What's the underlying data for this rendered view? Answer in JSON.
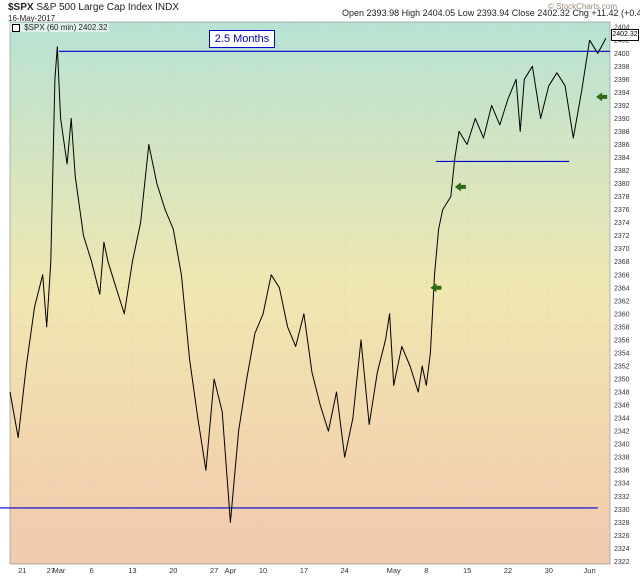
{
  "header": {
    "symbol": "$SPX",
    "name": "S&P 500 Large Cap Index",
    "exchange": "INDX",
    "date": "16-May-2017",
    "watermark": "© StockCharts.com",
    "open_label": "Open",
    "open": "2393.98",
    "high_label": "High",
    "high": "2404.05",
    "low_label": "Low",
    "low": "2393.94",
    "close_label": "Close",
    "close": "2402.32",
    "chg_label": "Chg",
    "chg": "+11.42 (+0.48%)",
    "legend_symbol": "$SPX (60 min)",
    "legend_value": "2402.32"
  },
  "annotation": {
    "label": "2.5 Months"
  },
  "colors": {
    "background_top": "#b7e3d3",
    "background_mid": "#f1e7b0",
    "background_bottom": "#f2c9ad",
    "price": "#000000",
    "lines": "#0000cc",
    "arrows": "#2d6b16",
    "grid": "#c9c9b8",
    "watermark": "#9b8a7a"
  },
  "chart_data": {
    "type": "line",
    "title": "$SPX S&P 500 Large Cap Index INDX",
    "timeframe": "60 min",
    "x_tick_labels": [
      "21",
      "27",
      "Mar",
      "6",
      "13",
      "20",
      "27",
      "Apr",
      "10",
      "17",
      "24",
      "May",
      "8",
      "15",
      "22",
      "30",
      "Jun"
    ],
    "x_tick_positions": [
      1.5,
      5,
      6,
      10,
      15,
      20,
      25,
      27,
      31,
      36,
      41,
      47,
      51,
      56,
      61,
      66,
      71
    ],
    "y_tick_labels": [
      2404,
      2402,
      2400,
      2398,
      2396,
      2394,
      2392,
      2390,
      2388,
      2386,
      2384,
      2382,
      2380,
      2378,
      2376,
      2374,
      2372,
      2370,
      2368,
      2366,
      2364,
      2362,
      2360,
      2358,
      2356,
      2354,
      2352,
      2350,
      2348,
      2346,
      2344,
      2342,
      2340,
      2338,
      2336,
      2334,
      2332,
      2330,
      2328,
      2326,
      2324,
      2322
    ],
    "ylim": [
      2321.6,
      2404.8
    ],
    "xlim": [
      0,
      73.5
    ],
    "series": [
      {
        "values": [
          [
            0,
            2348
          ],
          [
            1,
            2341
          ],
          [
            2,
            2352
          ],
          [
            3,
            2361
          ],
          [
            4,
            2366
          ],
          [
            4.5,
            2358
          ],
          [
            5,
            2368
          ],
          [
            5.5,
            2396
          ],
          [
            5.8,
            2401
          ],
          [
            6.2,
            2390
          ],
          [
            7,
            2383
          ],
          [
            7.5,
            2390
          ],
          [
            8,
            2381
          ],
          [
            9,
            2372
          ],
          [
            10,
            2368
          ],
          [
            11,
            2363
          ],
          [
            11.5,
            2371
          ],
          [
            12,
            2368
          ],
          [
            13,
            2364
          ],
          [
            14,
            2360
          ],
          [
            15,
            2368
          ],
          [
            16,
            2374
          ],
          [
            17,
            2386
          ],
          [
            18,
            2380
          ],
          [
            19,
            2376
          ],
          [
            20,
            2373
          ],
          [
            21,
            2366
          ],
          [
            22,
            2353
          ],
          [
            23,
            2344
          ],
          [
            24,
            2336
          ],
          [
            25,
            2350
          ],
          [
            26,
            2345
          ],
          [
            27,
            2328
          ],
          [
            27.5,
            2335
          ],
          [
            28,
            2342
          ],
          [
            29,
            2350
          ],
          [
            30,
            2357
          ],
          [
            31,
            2360
          ],
          [
            32,
            2366
          ],
          [
            33,
            2364
          ],
          [
            34,
            2358
          ],
          [
            35,
            2355
          ],
          [
            36,
            2360
          ],
          [
            37,
            2351
          ],
          [
            38,
            2346
          ],
          [
            39,
            2342
          ],
          [
            40,
            2348
          ],
          [
            41,
            2338
          ],
          [
            42,
            2344
          ],
          [
            43,
            2356
          ],
          [
            44,
            2343
          ],
          [
            45,
            2351
          ],
          [
            46,
            2356
          ],
          [
            46.5,
            2360
          ],
          [
            47,
            2349
          ],
          [
            48,
            2355
          ],
          [
            49,
            2352
          ],
          [
            50,
            2348
          ],
          [
            50.5,
            2352
          ],
          [
            51,
            2349
          ],
          [
            51.5,
            2354
          ],
          [
            52,
            2366
          ],
          [
            52.5,
            2373
          ],
          [
            53,
            2376
          ],
          [
            54,
            2378
          ],
          [
            54.5,
            2384
          ],
          [
            55,
            2388
          ],
          [
            56,
            2386
          ],
          [
            57,
            2390
          ],
          [
            58,
            2387
          ],
          [
            59,
            2392
          ],
          [
            60,
            2389
          ],
          [
            61,
            2393
          ],
          [
            62,
            2396
          ],
          [
            62.5,
            2388
          ],
          [
            63,
            2396
          ],
          [
            64,
            2398
          ],
          [
            65,
            2390
          ],
          [
            66,
            2395
          ],
          [
            67,
            2397
          ],
          [
            68,
            2395
          ],
          [
            69,
            2387
          ],
          [
            70,
            2394
          ],
          [
            71,
            2402
          ],
          [
            72,
            2400
          ],
          [
            73,
            2402.3
          ]
        ]
      }
    ],
    "reference_lines": [
      {
        "x1": 6,
        "x2": 73.5,
        "y": 2400.3
      },
      {
        "x1": 52.2,
        "x2": 68.5,
        "y": 2383.4
      },
      {
        "x1": 0,
        "x2": 72,
        "y": 2330.2
      }
    ],
    "arrows": [
      {
        "x": 71.8,
        "y": 2393.3,
        "direction": "left"
      },
      {
        "x": 54.5,
        "y": 2379.5,
        "direction": "left"
      },
      {
        "x": 51.5,
        "y": 2364.0,
        "direction": "left"
      }
    ],
    "grid": true,
    "legend_position": "top-left"
  }
}
